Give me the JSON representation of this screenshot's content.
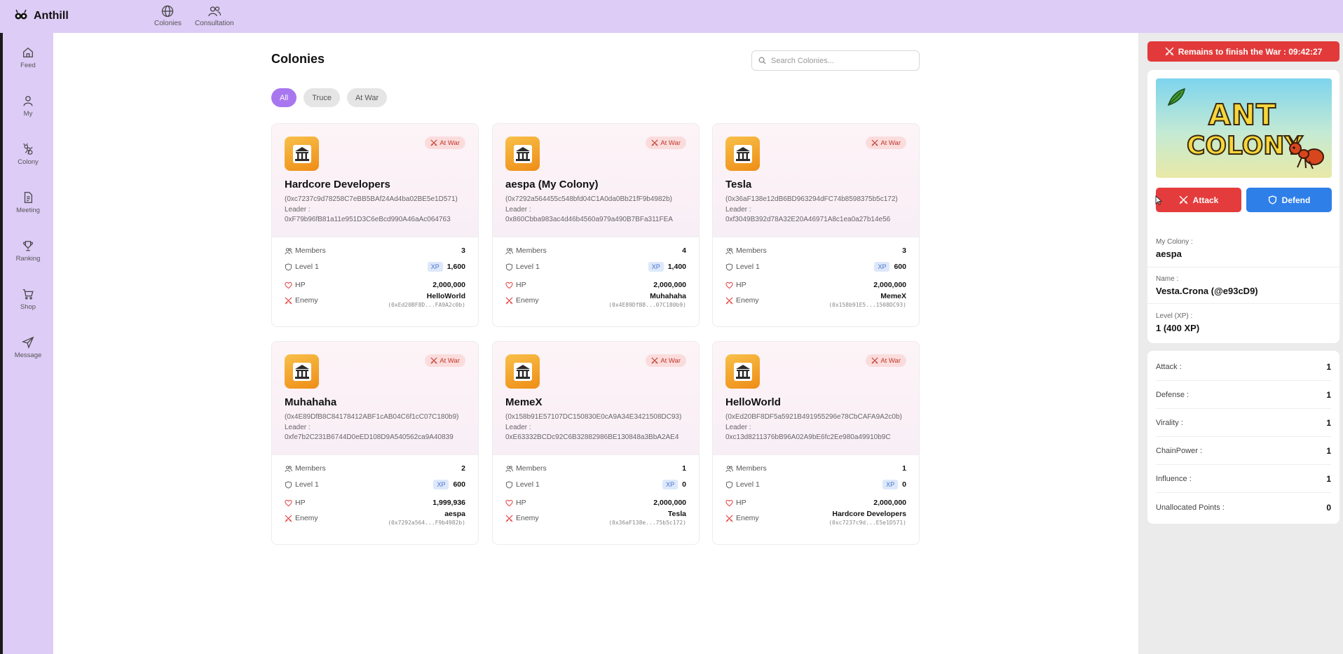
{
  "app": {
    "name": "Anthill"
  },
  "topnav": [
    {
      "label": "Colonies",
      "icon": "globe-icon"
    },
    {
      "label": "Consultation",
      "icon": "users-icon"
    }
  ],
  "sidebar": [
    {
      "label": "Feed",
      "icon": "home-icon"
    },
    {
      "label": "My",
      "icon": "user-icon"
    },
    {
      "label": "Colony",
      "icon": "ant-icon"
    },
    {
      "label": "Meeting",
      "icon": "document-icon"
    },
    {
      "label": "Ranking",
      "icon": "trophy-icon"
    },
    {
      "label": "Shop",
      "icon": "cart-icon"
    },
    {
      "label": "Message",
      "icon": "send-icon"
    }
  ],
  "main": {
    "title": "Colonies",
    "search_placeholder": "Search Colonies...",
    "filters": [
      {
        "label": "All",
        "active": true
      },
      {
        "label": "Truce",
        "active": false
      },
      {
        "label": "At War",
        "active": false
      }
    ],
    "labels": {
      "leader": "Leader :",
      "members": "Members",
      "level": "Level 1",
      "hp": "HP",
      "enemy": "Enemy",
      "xp": "XP",
      "war_badge": "At War"
    },
    "colonies": [
      {
        "name": "Hardcore Developers",
        "address": "(0xc7237c9d78258C7eBB5BAf24Ad4ba02BE5e1D571)",
        "leader": "0xF79b96fB81a11e951D3C6eBcd990A46aAc064763",
        "members": "3",
        "xp": "1,600",
        "hp": "2,000,000",
        "enemy_name": "HelloWorld",
        "enemy_addr": "(0xEd20BF8D...FA9A2c0b)"
      },
      {
        "name": "aespa (My Colony)",
        "address": "(0x7292a564455c548bfd04C1A0da0Bb21fF9b4982b)",
        "leader": "0x860Cbba983ac4d46b4560a979a490B7BFa311FEA",
        "members": "4",
        "xp": "1,400",
        "hp": "2,000,000",
        "enemy_name": "Muhahaha",
        "enemy_addr": "(0x4E89DfB8...07C180b9)"
      },
      {
        "name": "Tesla",
        "address": "(0x36aF138e12dB6BD963294dFC74b8598375b5c172)",
        "leader": "0xf3049B392d78A32E20A46971A8c1ea0a27b14e56",
        "members": "3",
        "xp": "600",
        "hp": "2,000,000",
        "enemy_name": "MemeX",
        "enemy_addr": "(0x158b91E5...1508DC93)"
      },
      {
        "name": "Muhahaha",
        "address": "(0x4E89DfB8C84178412ABF1cAB04C6f1cC07C180b9)",
        "leader": "0xfe7b2C231B6744D0eED108D9A540562ca9A40839",
        "members": "2",
        "xp": "600",
        "hp": "1,999,936",
        "enemy_name": "aespa",
        "enemy_addr": "(0x7292a564...F9b4982b)"
      },
      {
        "name": "MemeX",
        "address": "(0x158b91E57107DC150830E0cA9A34E3421508DC93)",
        "leader": "0xE63332BCDc92C6B32882986BE130848a3BbA2AE4",
        "members": "1",
        "xp": "0",
        "hp": "2,000,000",
        "enemy_name": "Tesla",
        "enemy_addr": "(0x36aF138e...75b5c172)"
      },
      {
        "name": "HelloWorld",
        "address": "(0xEd20BF8DF5a5921B491955296e78CbCAFA9A2c0b)",
        "leader": "0xc13d8211376bB96A02A9bE6fc2Ee980a49910b9C",
        "members": "1",
        "xp": "0",
        "hp": "2,000,000",
        "enemy_name": "Hardcore Developers",
        "enemy_addr": "(0xc7237c9d...E5e1D571)"
      }
    ]
  },
  "panel": {
    "timer": "Remains to finish the War : 09:42:27",
    "banner": {
      "line1": "ANT",
      "line2": "COLONY"
    },
    "attack_label": "Attack",
    "defend_label": "Defend",
    "my_colony_label": "My Colony :",
    "my_colony_value": "aespa",
    "name_label": "Name :",
    "name_value": "Vesta.Crona (@e93cD9)",
    "level_label": "Level (XP) :",
    "level_value": "1 (400 XP)",
    "stats": [
      {
        "label": "Attack :",
        "value": "1"
      },
      {
        "label": "Defense :",
        "value": "1"
      },
      {
        "label": "Virality :",
        "value": "1"
      },
      {
        "label": "ChainPower :",
        "value": "1"
      },
      {
        "label": "Influence :",
        "value": "1"
      },
      {
        "label": "Unallocated Points :",
        "value": "0"
      }
    ]
  },
  "colors": {
    "nav_bg": "#ddccf6",
    "accent": "#a877f0",
    "attack": "#e43c3c",
    "defend": "#2f7fe9",
    "war_badge_bg": "#fbdcdc"
  }
}
